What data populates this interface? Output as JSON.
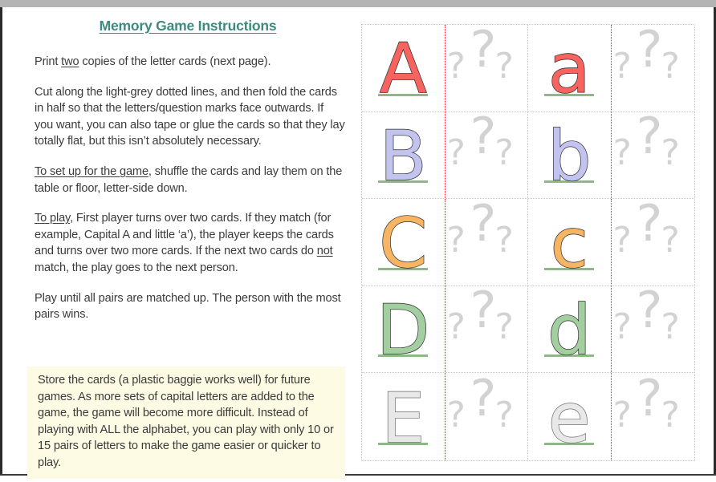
{
  "document": {
    "title": "Memory Game Instructions",
    "title_color": "#3f8a80",
    "body_text_color": "#3b3b3b",
    "note_background": "#fdfbe3"
  },
  "instructions": {
    "paragraphs": [
      "Print two copies of the letter cards (next page).",
      "Cut along the light-grey dotted lines, and then fold the cards in half so that the letters/question marks face outwards.  If you want, you can also tape or glue the cards so that they lay totally flat, but this isn’t absolutely necessary.",
      "To set up for the game, shuffle the cards and lay them on the table or floor, letter-side down.",
      "To play,  First player turns over two cards.  If they match (for example, Capital A and little ‘a’), the player keeps the cards and turns over two more cards.  If the next two cards do not match, the play goes to the next person.",
      "Play until all pairs are matched up.  The person with the most pairs wins."
    ],
    "note": "Store the cards (a plastic baggie works well) for future games.  As more sets of capital letters are added to the game, the game will become more difficult.  Instead of playing with ALL the alphabet, you can play with only 10 or 15 pairs of letters to make the game easier or quicker to play."
  },
  "card_grid": {
    "placeholder_symbol": "?",
    "fold_line_color": "#e8312b",
    "cut_line_color": "#c9c9c9",
    "baseline_color": "#8fb888",
    "rows": [
      {
        "capital": "A",
        "lowercase": "a",
        "color": "#f7635f",
        "back_label": "???"
      },
      {
        "capital": "B",
        "lowercase": "b",
        "color": "#c3c3f0",
        "back_label": "???"
      },
      {
        "capital": "C",
        "lowercase": "c",
        "color": "#f7b563",
        "back_label": "???"
      },
      {
        "capital": "D",
        "lowercase": "d",
        "color": "#a3cfa0",
        "back_label": "???"
      },
      {
        "capital": "E",
        "lowercase": "e",
        "color": "#e8e8e8",
        "back_label": "???"
      }
    ]
  }
}
